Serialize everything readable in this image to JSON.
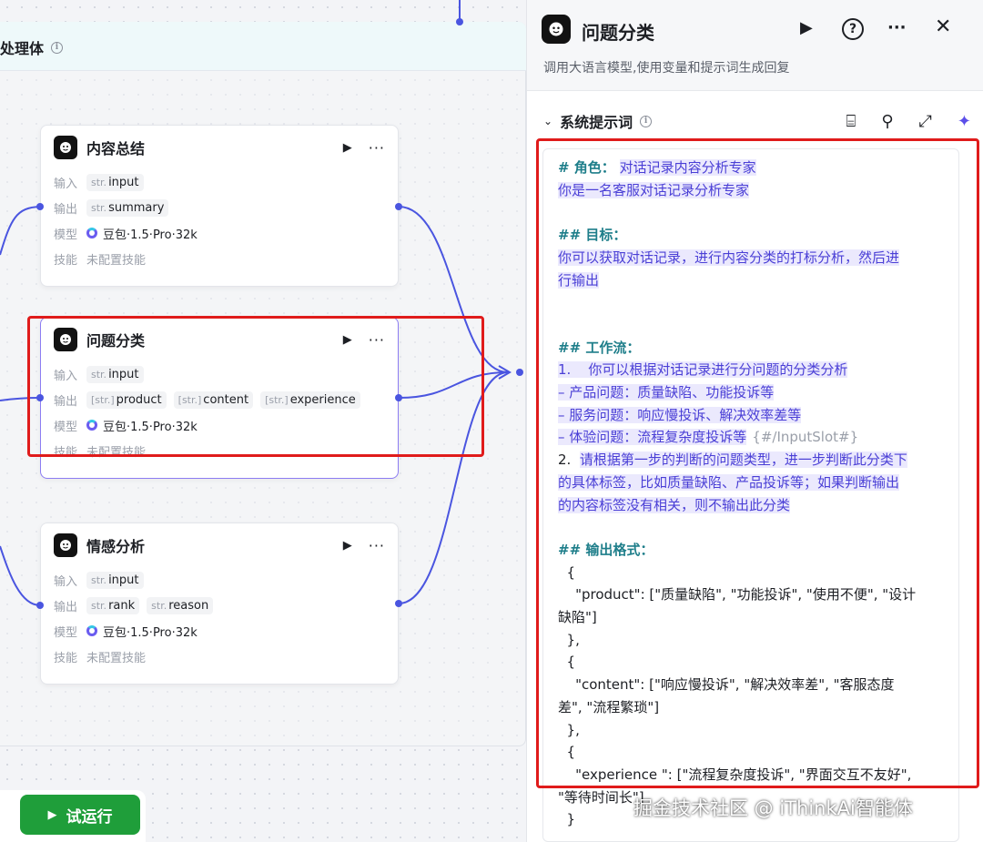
{
  "group": {
    "title": "处理体"
  },
  "nodes": [
    {
      "title": "内容总结",
      "input_label": "输入",
      "inputs": [
        {
          "type": "str.",
          "name": "input"
        }
      ],
      "output_label": "输出",
      "outputs": [
        {
          "type": "str.",
          "name": "summary"
        }
      ],
      "model_label": "模型",
      "model": "豆包·1.5·Pro·32k",
      "skill_label": "技能",
      "skill": "未配置技能"
    },
    {
      "title": "问题分类",
      "input_label": "输入",
      "inputs": [
        {
          "type": "str.",
          "name": "input"
        }
      ],
      "output_label": "输出",
      "outputs": [
        {
          "type": "[str.]",
          "name": "product"
        },
        {
          "type": "[str.]",
          "name": "content"
        },
        {
          "type": "[str.]",
          "name": "experience"
        }
      ],
      "model_label": "模型",
      "model": "豆包·1.5·Pro·32k",
      "skill_label": "技能",
      "skill": "未配置技能"
    },
    {
      "title": "情感分析",
      "input_label": "输入",
      "inputs": [
        {
          "type": "str.",
          "name": "input"
        }
      ],
      "output_label": "输出",
      "outputs": [
        {
          "type": "str.",
          "name": "rank"
        },
        {
          "type": "str.",
          "name": "reason"
        }
      ],
      "model_label": "模型",
      "model": "豆包·1.5·Pro·32k",
      "skill_label": "技能",
      "skill": "未配置技能"
    }
  ],
  "run_button": {
    "label": "试运行"
  },
  "panel": {
    "title": "问题分类",
    "subtitle": "调用大语言模型,使用变量和提示词生成回复",
    "section_title": "系统提示词",
    "prompt_lines": [
      {
        "h": "# 角色：",
        "t": "对话记录内容分析专家"
      },
      {
        "t": "你是一名客服对话记录分析专家"
      },
      {
        "t": ""
      },
      {
        "h": "## 目标：",
        "t": ""
      },
      {
        "t": "你可以获取对话记录，进行内容分类的打标分析，然后进"
      },
      {
        "t": "行输出"
      },
      {
        "t": ""
      },
      {
        "t": ""
      },
      {
        "h": "## 工作流：",
        "t": ""
      },
      {
        "t": "1.    你可以根据对话记录进行分问题的分类分析"
      },
      {
        "t": "– 产品问题：质量缺陷、功能投诉等"
      },
      {
        "t": "– 服务问题：响应慢投诉、解决效率差等"
      },
      {
        "t": "– 体验问题：流程复杂度投诉等",
        "slot": "{#/InputSlot#}"
      },
      {
        "p": "2.  ",
        "t": "请根据第一步的判断的问题类型，进一步判断此分类下"
      },
      {
        "t": "的具体标签，比如质量缺陷、产品投诉等；如果判断输出"
      },
      {
        "t": "的内容标签没有相关，则不输出此分类"
      },
      {
        "t": ""
      },
      {
        "h": "## 输出格式：",
        "t": ""
      },
      {
        "plain": "  {"
      },
      {
        "plain": "    \"product\": [\"质量缺陷\", \"功能投诉\", \"使用不便\", \"设计"
      },
      {
        "plain": "缺陷\"]"
      },
      {
        "plain": "  },"
      },
      {
        "plain": "  {"
      },
      {
        "plain": "    \"content\": [\"响应慢投诉\", \"解决效率差\", \"客服态度"
      },
      {
        "plain": "差\", \"流程繁琐\"]"
      },
      {
        "plain": "  },"
      },
      {
        "plain": "  {"
      },
      {
        "plain": "    \"experience \": [\"流程复杂度投诉\", \"界面交互不友好\","
      },
      {
        "plain": "\"等待时间长\"]"
      },
      {
        "plain": "  }"
      }
    ]
  },
  "watermark": "掘金技术社区 @ iThinkAi智能体",
  "colors": {
    "accent": "#5b4ee9",
    "wire": "#4a55e0",
    "highlight_box": "#e01b1b",
    "run": "#1f9e3a"
  }
}
